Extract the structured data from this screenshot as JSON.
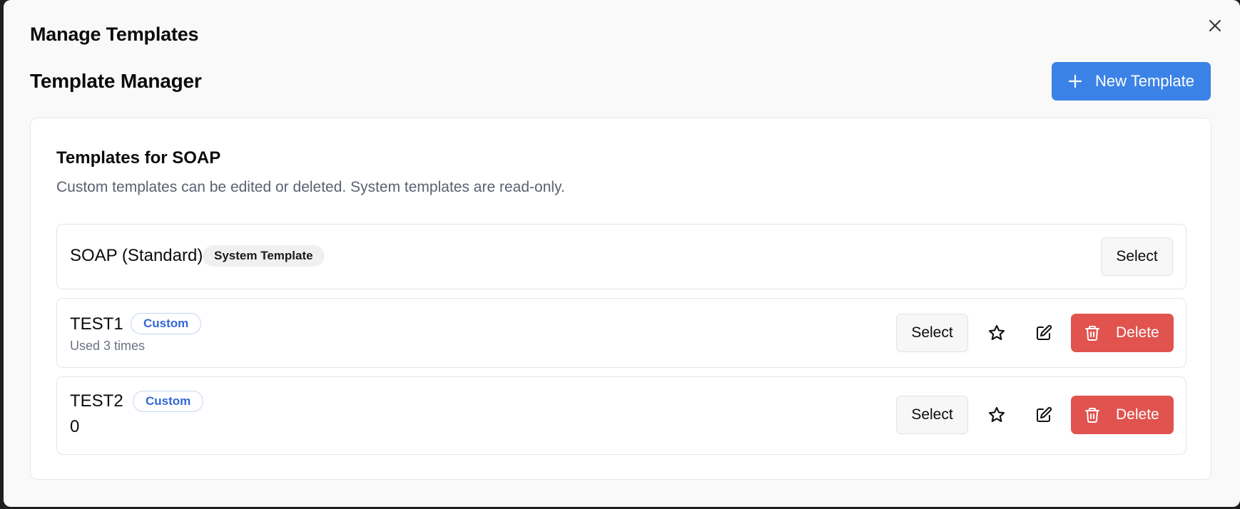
{
  "dialog": {
    "title": "Manage Templates",
    "close_icon": "close-icon"
  },
  "header": {
    "title": "Template Manager",
    "new_button_label": "New Template",
    "new_button_icon": "plus-icon",
    "accent_color": "#3b82e6"
  },
  "templates_card": {
    "title": "Templates for SOAP",
    "description": "Custom templates can be edited or deleted. System templates are read-only."
  },
  "templates": [
    {
      "name": "SOAP (Standard)",
      "badge": "System Template",
      "select_label": "Select"
    },
    {
      "name": "TEST1",
      "badge": "Custom",
      "usage": "Used 3 times",
      "select_label": "Select",
      "delete_label": "Delete"
    },
    {
      "name": "TEST2",
      "badge": "Custom",
      "usage": "0",
      "select_label": "Select",
      "delete_label": "Delete"
    }
  ],
  "colors": {
    "delete": "#e0534e",
    "custom_badge_text": "#3566d6"
  }
}
